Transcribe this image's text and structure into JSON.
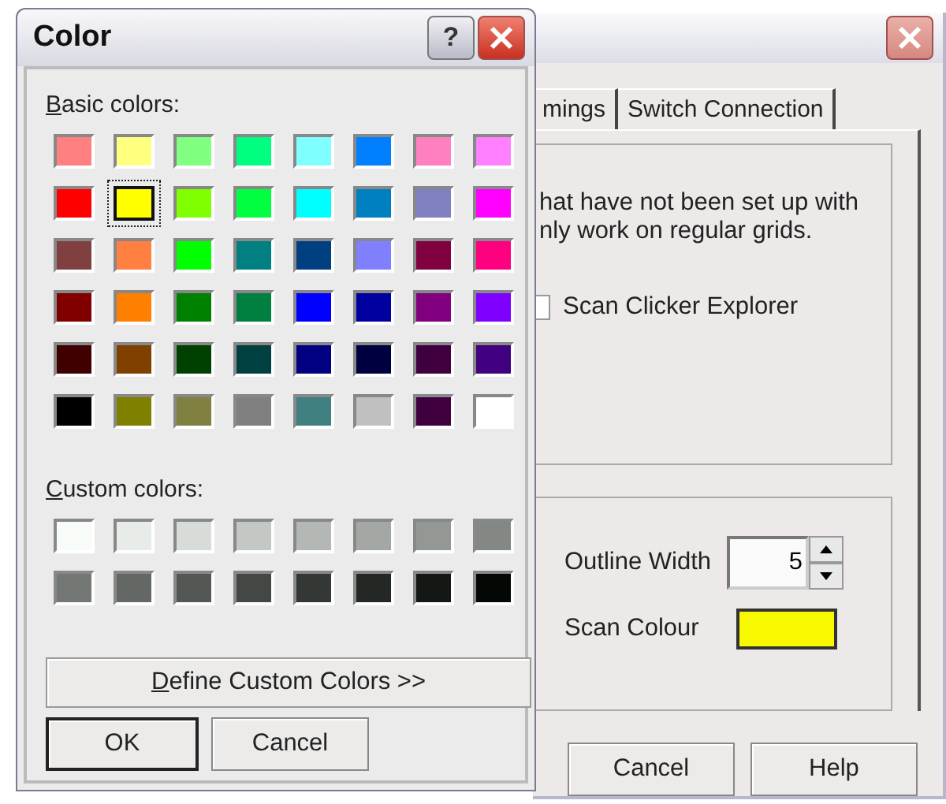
{
  "back_window": {
    "tabs": [
      {
        "label": "mings",
        "selected": false
      },
      {
        "label": "Switch Connection",
        "selected": false
      }
    ],
    "description_lines": [
      "hat have not been set up with",
      "nly work on regular grids."
    ],
    "checkbox": {
      "label": "Scan Clicker Explorer",
      "checked": false
    },
    "outline_width": {
      "label": "Outline Width",
      "value": "5"
    },
    "scan_colour": {
      "label": "Scan Colour",
      "color": "#f8f800"
    },
    "buttons": [
      "Cancel",
      "Help"
    ]
  },
  "color_dialog": {
    "title": "Color",
    "help_button": "?",
    "basic_label": "Basic colors:",
    "basic_colors": [
      {
        "color": "#ff8080",
        "selected": false
      },
      {
        "color": "#ffff80",
        "selected": false
      },
      {
        "color": "#80ff80",
        "selected": false
      },
      {
        "color": "#00ff80",
        "selected": false
      },
      {
        "color": "#80ffff",
        "selected": false
      },
      {
        "color": "#0080ff",
        "selected": false
      },
      {
        "color": "#ff80c0",
        "selected": false
      },
      {
        "color": "#ff80ff",
        "selected": false
      },
      {
        "color": "#ff0000",
        "selected": false
      },
      {
        "color": "#ffff00",
        "selected": true
      },
      {
        "color": "#80ff00",
        "selected": false
      },
      {
        "color": "#00ff40",
        "selected": false
      },
      {
        "color": "#00ffff",
        "selected": false
      },
      {
        "color": "#0080c0",
        "selected": false
      },
      {
        "color": "#8080c0",
        "selected": false
      },
      {
        "color": "#ff00ff",
        "selected": false
      },
      {
        "color": "#804040",
        "selected": false
      },
      {
        "color": "#ff8040",
        "selected": false
      },
      {
        "color": "#00ff00",
        "selected": false
      },
      {
        "color": "#008080",
        "selected": false
      },
      {
        "color": "#004080",
        "selected": false
      },
      {
        "color": "#8080ff",
        "selected": false
      },
      {
        "color": "#800040",
        "selected": false
      },
      {
        "color": "#ff0080",
        "selected": false
      },
      {
        "color": "#800000",
        "selected": false
      },
      {
        "color": "#ff8000",
        "selected": false
      },
      {
        "color": "#008000",
        "selected": false
      },
      {
        "color": "#008040",
        "selected": false
      },
      {
        "color": "#0000ff",
        "selected": false
      },
      {
        "color": "#0000a0",
        "selected": false
      },
      {
        "color": "#800080",
        "selected": false
      },
      {
        "color": "#8000ff",
        "selected": false
      },
      {
        "color": "#400000",
        "selected": false
      },
      {
        "color": "#804000",
        "selected": false
      },
      {
        "color": "#004000",
        "selected": false
      },
      {
        "color": "#004040",
        "selected": false
      },
      {
        "color": "#000080",
        "selected": false
      },
      {
        "color": "#000040",
        "selected": false
      },
      {
        "color": "#400040",
        "selected": false
      },
      {
        "color": "#400080",
        "selected": false
      },
      {
        "color": "#000000",
        "selected": false
      },
      {
        "color": "#808000",
        "selected": false
      },
      {
        "color": "#808040",
        "selected": false
      },
      {
        "color": "#808080",
        "selected": false
      },
      {
        "color": "#408080",
        "selected": false
      },
      {
        "color": "#c0c0c0",
        "selected": false
      },
      {
        "color": "#400040",
        "selected": false
      },
      {
        "color": "#ffffff",
        "selected": false
      }
    ],
    "custom_label": "Custom colors:",
    "custom_colors": [
      {
        "color": "#f8fcf8",
        "selected": false
      },
      {
        "color": "#e8ece8",
        "selected": false
      },
      {
        "color": "#d8dcd8",
        "selected": false
      },
      {
        "color": "#c4c8c4",
        "selected": false
      },
      {
        "color": "#b4b8b4",
        "selected": false
      },
      {
        "color": "#a4a8a4",
        "selected": false
      },
      {
        "color": "#949894",
        "selected": false
      },
      {
        "color": "#848884",
        "selected": false
      },
      {
        "color": "#747874",
        "selected": false
      },
      {
        "color": "#646864",
        "selected": false
      },
      {
        "color": "#545854",
        "selected": false
      },
      {
        "color": "#444844",
        "selected": false
      },
      {
        "color": "#343834",
        "selected": false
      },
      {
        "color": "#242824",
        "selected": false
      },
      {
        "color": "#141814",
        "selected": false
      },
      {
        "color": "#040804",
        "selected": false
      }
    ],
    "define_button": "Define Custom Colors >>",
    "buttons": [
      {
        "label": "OK",
        "default": true
      },
      {
        "label": "Cancel",
        "default": false
      }
    ]
  }
}
